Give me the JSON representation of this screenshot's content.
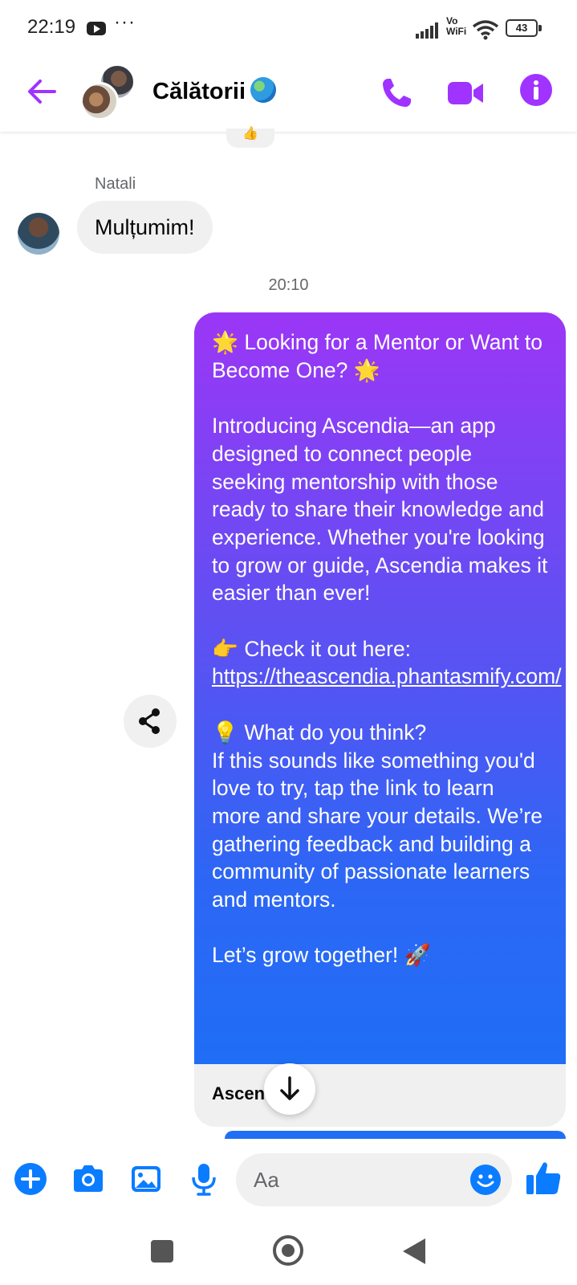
{
  "status_bar": {
    "time": "22:19",
    "more": "···",
    "network_label_line1": "Vo",
    "network_label_line2": "WiFi",
    "battery": "43"
  },
  "header": {
    "title": "Călătorii",
    "title_emoji_icon": "globe-icon",
    "accent_color": "#a033ff"
  },
  "conversation": {
    "reaction_peek": "👍",
    "sender_name": "Natali",
    "incoming_message": "Mulțumim!",
    "timestamp": "20:10",
    "outgoing_message": {
      "p1": "🌟 Looking for a Mentor or Want to Become One? 🌟",
      "p2": "Introducing Ascendia—an app designed to connect people seeking mentorship with those ready to share their knowledge and experience. Whether you're looking to grow or guide, Ascendia makes it easier than ever!",
      "p3_prefix": "👉 Check it out here:",
      "link": "https://theascendia.phantasmify.com/",
      "p4_title": "💡 What do you think?",
      "p4_body": "If this sounds like something you'd love to try, tap the link to learn more and share your details. We’re gathering feedback and building a community of passionate learners and mentors.",
      "p5": "Let’s grow together! 🚀"
    },
    "link_preview_title": "Ascendia",
    "bubble_gradient": [
      "#9b36f6",
      "#5a52f2",
      "#1f6ef5"
    ]
  },
  "composer": {
    "placeholder": "Aa",
    "accent_color": "#0a7cff"
  }
}
